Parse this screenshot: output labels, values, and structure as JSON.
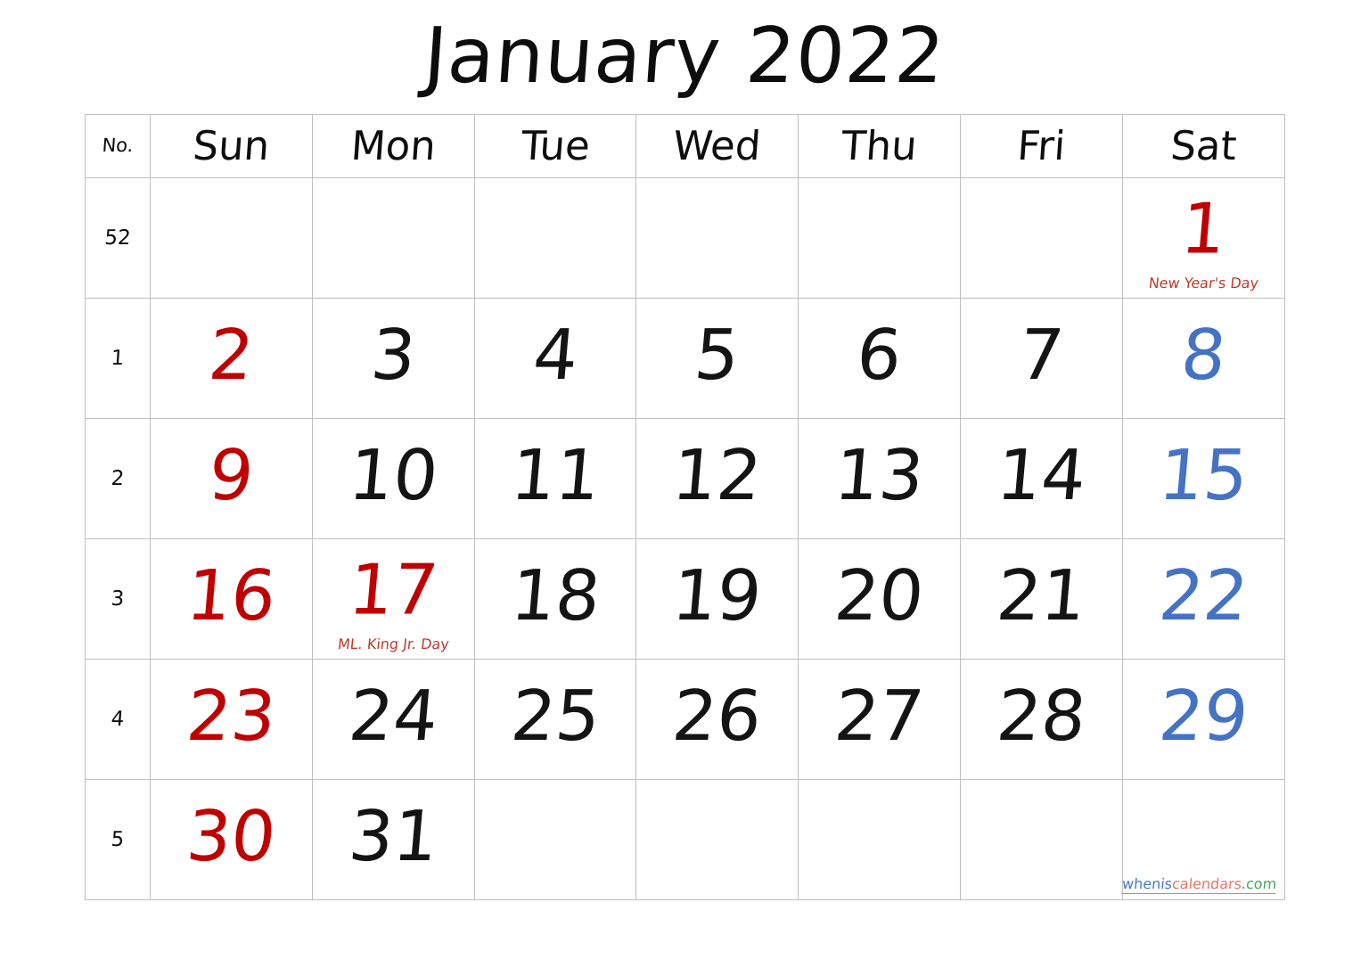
{
  "title": "January 2022",
  "header": {
    "weekno_label": "No.",
    "days": [
      "Sun",
      "Mon",
      "Tue",
      "Wed",
      "Thu",
      "Fri",
      "Sat"
    ]
  },
  "colors": {
    "sunday": "#C00000",
    "saturday": "#4472C4",
    "weekday": "#141414",
    "holiday_text": "#C0392B",
    "cell_filled": "#EFEFEF",
    "cell_empty": "#FFFFFF",
    "border": "#BFBFBF"
  },
  "weeks": [
    {
      "number": "52",
      "days": [
        {
          "date": "",
          "kind": "empty",
          "holiday": ""
        },
        {
          "date": "",
          "kind": "empty",
          "holiday": ""
        },
        {
          "date": "",
          "kind": "empty",
          "holiday": ""
        },
        {
          "date": "",
          "kind": "empty",
          "holiday": ""
        },
        {
          "date": "",
          "kind": "empty",
          "holiday": ""
        },
        {
          "date": "",
          "kind": "empty",
          "holiday": ""
        },
        {
          "date": "1",
          "kind": "holiday",
          "holiday": "New Year's Day"
        }
      ]
    },
    {
      "number": "1",
      "days": [
        {
          "date": "2",
          "kind": "sun",
          "holiday": ""
        },
        {
          "date": "3",
          "kind": "wk",
          "holiday": ""
        },
        {
          "date": "4",
          "kind": "wk",
          "holiday": ""
        },
        {
          "date": "5",
          "kind": "wk",
          "holiday": ""
        },
        {
          "date": "6",
          "kind": "wk",
          "holiday": ""
        },
        {
          "date": "7",
          "kind": "wk",
          "holiday": ""
        },
        {
          "date": "8",
          "kind": "sat",
          "holiday": ""
        }
      ]
    },
    {
      "number": "2",
      "days": [
        {
          "date": "9",
          "kind": "sun",
          "holiday": ""
        },
        {
          "date": "10",
          "kind": "wk",
          "holiday": ""
        },
        {
          "date": "11",
          "kind": "wk",
          "holiday": ""
        },
        {
          "date": "12",
          "kind": "wk",
          "holiday": ""
        },
        {
          "date": "13",
          "kind": "wk",
          "holiday": ""
        },
        {
          "date": "14",
          "kind": "wk",
          "holiday": ""
        },
        {
          "date": "15",
          "kind": "sat",
          "holiday": ""
        }
      ]
    },
    {
      "number": "3",
      "days": [
        {
          "date": "16",
          "kind": "sun",
          "holiday": ""
        },
        {
          "date": "17",
          "kind": "holiday",
          "holiday": "ML. King Jr. Day"
        },
        {
          "date": "18",
          "kind": "wk",
          "holiday": ""
        },
        {
          "date": "19",
          "kind": "wk",
          "holiday": ""
        },
        {
          "date": "20",
          "kind": "wk",
          "holiday": ""
        },
        {
          "date": "21",
          "kind": "wk",
          "holiday": ""
        },
        {
          "date": "22",
          "kind": "sat",
          "holiday": ""
        }
      ]
    },
    {
      "number": "4",
      "days": [
        {
          "date": "23",
          "kind": "sun",
          "holiday": ""
        },
        {
          "date": "24",
          "kind": "wk",
          "holiday": ""
        },
        {
          "date": "25",
          "kind": "wk",
          "holiday": ""
        },
        {
          "date": "26",
          "kind": "wk",
          "holiday": ""
        },
        {
          "date": "27",
          "kind": "wk",
          "holiday": ""
        },
        {
          "date": "28",
          "kind": "wk",
          "holiday": ""
        },
        {
          "date": "29",
          "kind": "sat",
          "holiday": ""
        }
      ]
    },
    {
      "number": "5",
      "days": [
        {
          "date": "30",
          "kind": "sun",
          "holiday": ""
        },
        {
          "date": "31",
          "kind": "wk",
          "holiday": ""
        },
        {
          "date": "",
          "kind": "empty",
          "holiday": ""
        },
        {
          "date": "",
          "kind": "empty",
          "holiday": ""
        },
        {
          "date": "",
          "kind": "empty",
          "holiday": ""
        },
        {
          "date": "",
          "kind": "empty",
          "holiday": ""
        },
        {
          "date": "",
          "kind": "empty",
          "holiday": ""
        }
      ]
    }
  ],
  "watermark": {
    "part1": "whenis",
    "part2": "calendars",
    "part3": ".com"
  }
}
